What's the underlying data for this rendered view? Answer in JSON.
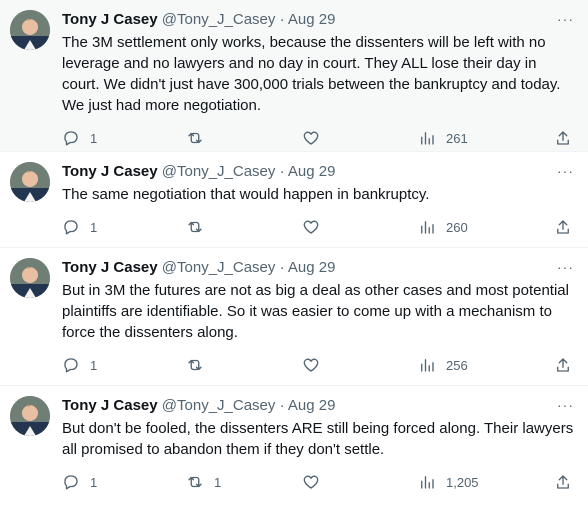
{
  "tweets": [
    {
      "name": "Tony J Casey",
      "handle": "@Tony_J_Casey",
      "dot": "·",
      "time": "Aug 29",
      "text": "The 3M settlement only works, because the dissenters will be left with no leverage and no lawyers and no day in court. They ALL lose their day in court. We didn't just have 300,000 trials between the bankruptcy and today. We just had more negotiation.",
      "replies": "1",
      "retweets": "",
      "likes": "",
      "views": "261"
    },
    {
      "name": "Tony J Casey",
      "handle": "@Tony_J_Casey",
      "dot": "·",
      "time": "Aug 29",
      "text": "The same negotiation that would happen in bankruptcy.",
      "replies": "1",
      "retweets": "",
      "likes": "",
      "views": "260"
    },
    {
      "name": "Tony J Casey",
      "handle": "@Tony_J_Casey",
      "dot": "·",
      "time": "Aug 29",
      "text": "But in 3M the futures are not as big a deal as other cases and most potential plaintiffs are identifiable. So it was easier to come up with a mechanism to force the dissenters along.",
      "replies": "1",
      "retweets": "",
      "likes": "",
      "views": "256"
    },
    {
      "name": "Tony J Casey",
      "handle": "@Tony_J_Casey",
      "dot": "·",
      "time": "Aug 29",
      "text": "But don't be fooled, the dissenters ARE still being forced along. Their lawyers all promised to abandon them if they don't settle.",
      "replies": "1",
      "retweets": "1",
      "likes": "",
      "views": "1,205"
    }
  ]
}
